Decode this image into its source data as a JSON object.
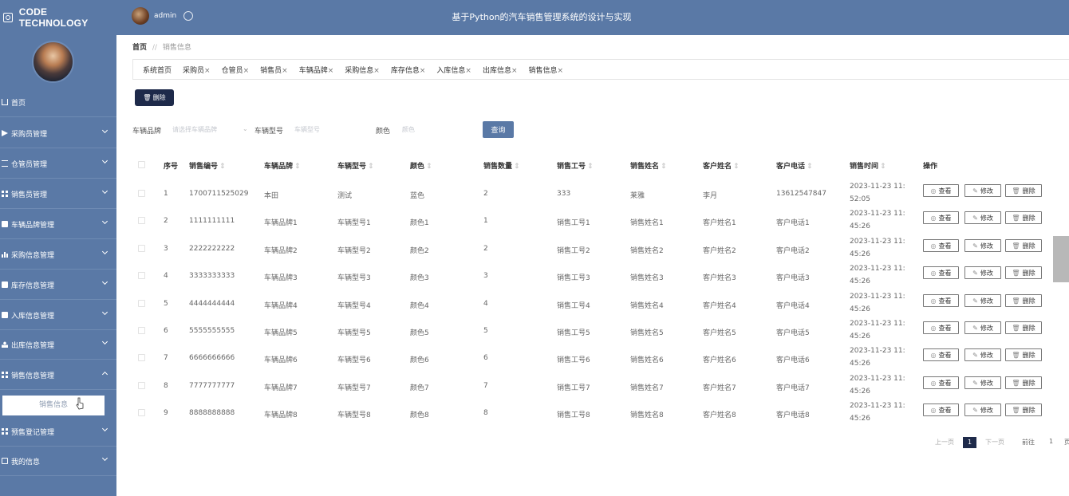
{
  "header": {
    "brand": "CODE TECHNOLOGY",
    "user": "admin",
    "system_title": "基于Python的汽车销售管理系统的设计与实现"
  },
  "sidebar": {
    "items": [
      {
        "label": "首页",
        "icon": "home-icon"
      },
      {
        "label": "采购员管理",
        "icon": "send-icon"
      },
      {
        "label": "仓管员管理",
        "icon": "list-icon"
      },
      {
        "label": "销售员管理",
        "icon": "grid-icon"
      },
      {
        "label": "车辆品牌管理",
        "icon": "comment-icon"
      },
      {
        "label": "采购信息管理",
        "icon": "bar-chart-icon"
      },
      {
        "label": "库存信息管理",
        "icon": "box-icon"
      },
      {
        "label": "入库信息管理",
        "icon": "monitor-icon"
      },
      {
        "label": "出库信息管理",
        "icon": "user-icon"
      },
      {
        "label": "销售信息管理",
        "icon": "grid-icon"
      },
      {
        "label": "预售登记管理",
        "icon": "grid-icon"
      },
      {
        "label": "我的信息",
        "icon": "card-icon"
      }
    ],
    "subitem": "销售信息"
  },
  "breadcrumb": {
    "home": "首页",
    "separator": "//",
    "current": "销售信息"
  },
  "tabs": [
    {
      "label": "系统首页",
      "closable": false
    },
    {
      "label": "采购员",
      "closable": true
    },
    {
      "label": "仓管员",
      "closable": true
    },
    {
      "label": "销售员",
      "closable": true
    },
    {
      "label": "车辆品牌",
      "closable": true
    },
    {
      "label": "采购信息",
      "closable": true
    },
    {
      "label": "库存信息",
      "closable": true
    },
    {
      "label": "入库信息",
      "closable": true
    },
    {
      "label": "出库信息",
      "closable": true
    },
    {
      "label": "销售信息",
      "closable": true
    }
  ],
  "tab_close": "×",
  "toolbar": {
    "delete_label": "删除"
  },
  "filters": {
    "brand_label": "车辆品牌",
    "brand_placeholder": "请选择车辆品牌",
    "model_label": "车辆型号",
    "model_placeholder": "车辆型号",
    "color_label": "颜色",
    "color_placeholder": "颜色",
    "query_label": "查询"
  },
  "table": {
    "columns": [
      "序号",
      "销售编号",
      "车辆品牌",
      "车辆型号",
      "颜色",
      "销售数量",
      "销售工号",
      "销售姓名",
      "客户姓名",
      "客户电话",
      "销售时间",
      "操作"
    ],
    "sort_mark": "⇕",
    "rows": [
      {
        "idx": "1",
        "no": "1700711525029",
        "brand": "本田",
        "model": "测试",
        "color": "蓝色",
        "qty": "2",
        "emp": "333",
        "name": "莱雅",
        "cust": "李月",
        "phone": "13612547847",
        "time": "2023-11-23 11:52:05"
      },
      {
        "idx": "2",
        "no": "1111111111",
        "brand": "车辆品牌1",
        "model": "车辆型号1",
        "color": "颜色1",
        "qty": "1",
        "emp": "销售工号1",
        "name": "销售姓名1",
        "cust": "客户姓名1",
        "phone": "客户电话1",
        "time": "2023-11-23 11:45:26"
      },
      {
        "idx": "3",
        "no": "2222222222",
        "brand": "车辆品牌2",
        "model": "车辆型号2",
        "color": "颜色2",
        "qty": "2",
        "emp": "销售工号2",
        "name": "销售姓名2",
        "cust": "客户姓名2",
        "phone": "客户电话2",
        "time": "2023-11-23 11:45:26"
      },
      {
        "idx": "4",
        "no": "3333333333",
        "brand": "车辆品牌3",
        "model": "车辆型号3",
        "color": "颜色3",
        "qty": "3",
        "emp": "销售工号3",
        "name": "销售姓名3",
        "cust": "客户姓名3",
        "phone": "客户电话3",
        "time": "2023-11-23 11:45:26"
      },
      {
        "idx": "5",
        "no": "4444444444",
        "brand": "车辆品牌4",
        "model": "车辆型号4",
        "color": "颜色4",
        "qty": "4",
        "emp": "销售工号4",
        "name": "销售姓名4",
        "cust": "客户姓名4",
        "phone": "客户电话4",
        "time": "2023-11-23 11:45:26"
      },
      {
        "idx": "6",
        "no": "5555555555",
        "brand": "车辆品牌5",
        "model": "车辆型号5",
        "color": "颜色5",
        "qty": "5",
        "emp": "销售工号5",
        "name": "销售姓名5",
        "cust": "客户姓名5",
        "phone": "客户电话5",
        "time": "2023-11-23 11:45:26"
      },
      {
        "idx": "7",
        "no": "6666666666",
        "brand": "车辆品牌6",
        "model": "车辆型号6",
        "color": "颜色6",
        "qty": "6",
        "emp": "销售工号6",
        "name": "销售姓名6",
        "cust": "客户姓名6",
        "phone": "客户电话6",
        "time": "2023-11-23 11:45:26"
      },
      {
        "idx": "8",
        "no": "7777777777",
        "brand": "车辆品牌7",
        "model": "车辆型号7",
        "color": "颜色7",
        "qty": "7",
        "emp": "销售工号7",
        "name": "销售姓名7",
        "cust": "客户姓名7",
        "phone": "客户电话7",
        "time": "2023-11-23 11:45:26"
      },
      {
        "idx": "9",
        "no": "8888888888",
        "brand": "车辆品牌8",
        "model": "车辆型号8",
        "color": "颜色8",
        "qty": "8",
        "emp": "销售工号8",
        "name": "销售姓名8",
        "cust": "客户姓名8",
        "phone": "客户电话8",
        "time": "2023-11-23 11:45:26"
      }
    ],
    "actions": {
      "view": "查看",
      "edit": "修改",
      "delete": "删除"
    }
  },
  "pagination": {
    "prev": "上一页",
    "current": "1",
    "next": "下一页",
    "goto": "前往",
    "goto_value": "1",
    "page_suffix": "页"
  }
}
